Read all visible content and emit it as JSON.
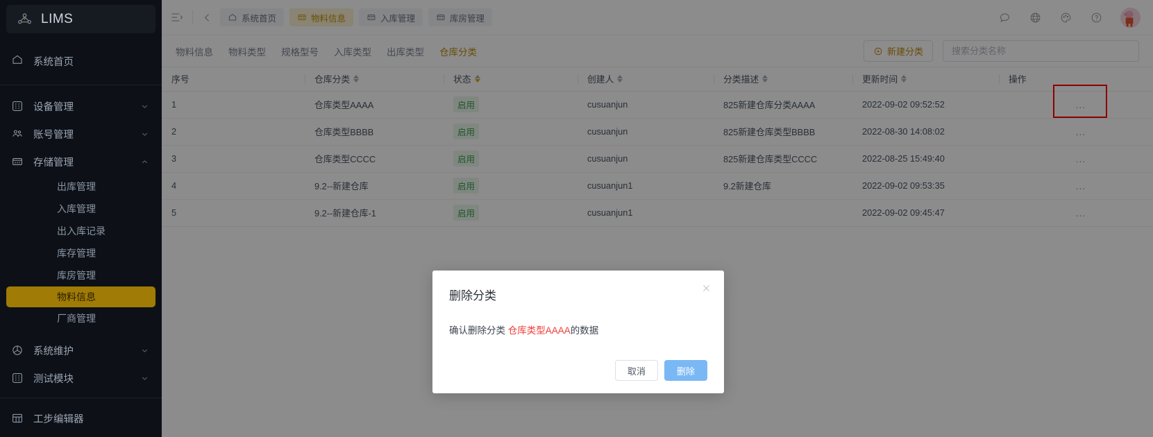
{
  "app": {
    "brand": "LIMS",
    "logo_icon": "network-node-icon"
  },
  "sidebar": {
    "home": {
      "label": "系统首页",
      "icon": "home-icon"
    },
    "groups": [
      {
        "label": "设备管理",
        "icon": "device-grid-icon",
        "expanded": false
      },
      {
        "label": "账号管理",
        "icon": "users-icon",
        "expanded": false
      },
      {
        "label": "存储管理",
        "icon": "storage-box-icon",
        "expanded": true
      }
    ],
    "storage_children": [
      {
        "label": "出库管理",
        "active": false
      },
      {
        "label": "入库管理",
        "active": false
      },
      {
        "label": "出入库记录",
        "active": false
      },
      {
        "label": "库存管理",
        "active": false
      },
      {
        "label": "库房管理",
        "active": false
      },
      {
        "label": "物料信息",
        "active": true
      },
      {
        "label": "厂商管理",
        "active": false
      }
    ],
    "groups_tail": [
      {
        "label": "系统维护",
        "icon": "wrench-circle-icon",
        "expanded": false
      },
      {
        "label": "测试模块",
        "icon": "test-grid-icon",
        "expanded": false
      }
    ],
    "footer_item": {
      "label": "工步编辑器",
      "icon": "table-icon"
    },
    "active_color": "#a07b06"
  },
  "topbar": {
    "menu_toggle_icon": "menu-collapse-icon",
    "back_icon": "chevron-left-icon",
    "tabs": [
      {
        "label": "系统首页",
        "icon": "home-icon",
        "active": false
      },
      {
        "label": "物料信息",
        "icon": "storage-box-icon",
        "active": true
      },
      {
        "label": "入库管理",
        "icon": "storage-box-icon",
        "active": false
      },
      {
        "label": "库房管理",
        "icon": "storage-box-icon",
        "active": false
      }
    ],
    "right_icons": [
      {
        "name": "chat-icon"
      },
      {
        "name": "globe-icon"
      },
      {
        "name": "palette-icon"
      },
      {
        "name": "help-icon"
      }
    ],
    "avatar_name": "user-avatar",
    "active_tab_color": "#c39309"
  },
  "subnav": {
    "tabs": [
      {
        "label": "物料信息",
        "active": false
      },
      {
        "label": "物料类型",
        "active": false
      },
      {
        "label": "规格型号",
        "active": false
      },
      {
        "label": "入库类型",
        "active": false
      },
      {
        "label": "出库类型",
        "active": false
      },
      {
        "label": "仓库分类",
        "active": true
      }
    ],
    "new_button": {
      "label": "新建分类",
      "icon": "plus-circle-icon"
    },
    "search": {
      "placeholder": "搜索分类名称",
      "value": ""
    }
  },
  "table": {
    "columns": [
      {
        "label": "序号",
        "sortable": false,
        "sort_active": false
      },
      {
        "label": "仓库分类",
        "sortable": true,
        "sort_active": false
      },
      {
        "label": "状态",
        "sortable": true,
        "sort_active": true
      },
      {
        "label": "创建人",
        "sortable": true,
        "sort_active": false
      },
      {
        "label": "分类描述",
        "sortable": true,
        "sort_active": false
      },
      {
        "label": "更新时间",
        "sortable": true,
        "sort_active": false
      },
      {
        "label": "操作",
        "sortable": false,
        "sort_active": false
      }
    ],
    "rows": [
      {
        "index": "1",
        "category": "仓库类型AAAA",
        "status": "启用",
        "creator": "cusuanjun",
        "desc": "825新建仓库分类AAAA",
        "updated": "2022-09-02 09:52:52",
        "action": "..."
      },
      {
        "index": "2",
        "category": "仓库类型BBBB",
        "status": "启用",
        "creator": "cusuanjun",
        "desc": "825新建仓库类型BBBB",
        "updated": "2022-08-30 14:08:02",
        "action": "..."
      },
      {
        "index": "3",
        "category": "仓库类型CCCC",
        "status": "启用",
        "creator": "cusuanjun",
        "desc": "825新建仓库类型CCCC",
        "updated": "2022-08-25 15:49:40",
        "action": "..."
      },
      {
        "index": "4",
        "category": "9.2--新建仓库",
        "status": "启用",
        "creator": "cusuanjun1",
        "desc": "9.2新建仓库",
        "updated": "2022-09-02 09:53:35",
        "action": "..."
      },
      {
        "index": "5",
        "category": "9.2--新建仓库-1",
        "status": "启用",
        "creator": "cusuanjun1",
        "desc": "",
        "updated": "2022-09-02 09:45:47",
        "action": "..."
      }
    ],
    "highlight": {
      "name": "row-1-action-highlight",
      "color": "#ff0000"
    },
    "status_color": "#3a9d4e"
  },
  "modal": {
    "title": "删除分类",
    "close_icon": "close-icon",
    "message_prefix": "确认删除分类 ",
    "message_target": "仓库类型AAAA",
    "message_suffix": "的数据",
    "cancel_label": "取消",
    "confirm_label": "删除",
    "target_color": "#f03b36",
    "confirm_color": "#7ab8f5"
  }
}
